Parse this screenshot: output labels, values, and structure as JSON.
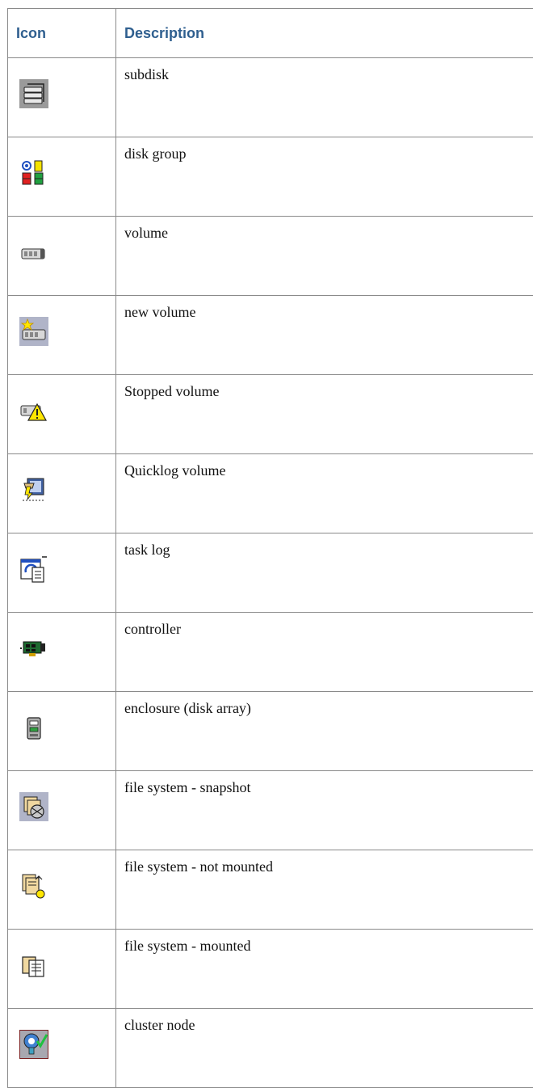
{
  "table": {
    "header_icon": "Icon",
    "header_description": "Description",
    "rows": [
      {
        "icon": "subdisk-icon",
        "description": "subdisk"
      },
      {
        "icon": "disk-group-icon",
        "description": "disk group"
      },
      {
        "icon": "volume-icon",
        "description": "volume"
      },
      {
        "icon": "new-volume-icon",
        "description": "new volume"
      },
      {
        "icon": "stopped-volume-icon",
        "description": "Stopped volume"
      },
      {
        "icon": "quicklog-volume-icon",
        "description": "Quicklog volume"
      },
      {
        "icon": "task-log-icon",
        "description": "task log"
      },
      {
        "icon": "controller-icon",
        "description": "controller"
      },
      {
        "icon": "enclosure-icon",
        "description": "enclosure (disk array)"
      },
      {
        "icon": "fs-snapshot-icon",
        "description": "file system - snapshot"
      },
      {
        "icon": "fs-not-mounted-icon",
        "description": "file system - not mounted"
      },
      {
        "icon": "fs-mounted-icon",
        "description": "file system - mounted"
      },
      {
        "icon": "cluster-node-icon",
        "description": "cluster node"
      }
    ]
  },
  "colors": {
    "header_text": "#2f5f8f",
    "border": "#8a8a8a",
    "body_text": "#111111"
  }
}
